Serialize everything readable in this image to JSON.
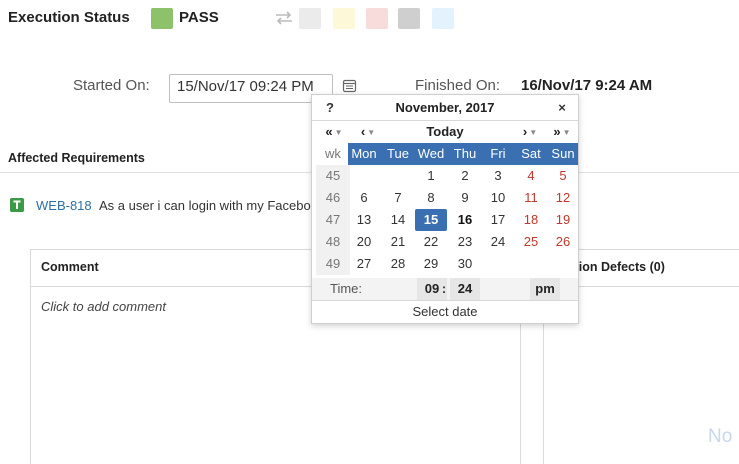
{
  "execution": {
    "label": "Execution Status",
    "status": "PASS",
    "status_color": "#8dc26a",
    "alt_status_colors": [
      "#ebebeb",
      "#fdf9d8",
      "#f7dcdc",
      "#cfcfcf",
      "#e3f2fc"
    ]
  },
  "dates": {
    "started_label": "Started On:",
    "started_value": "15/Nov/17 09:24 PM",
    "finished_label": "Finished On:",
    "finished_value": "16/Nov/17 9:24 AM"
  },
  "requirements": {
    "title": "Affected Requirements",
    "item": {
      "id": "WEB-818",
      "text": "As a user i can login with my Facebo"
    }
  },
  "comment": {
    "title": "Comment",
    "placeholder": "Click to add comment"
  },
  "defects": {
    "title": "cution Defects (0)",
    "empty": "No"
  },
  "calendar": {
    "help": "?",
    "month": "November, 2017",
    "close": "×",
    "nav": {
      "prev_year": "«",
      "prev_month": "‹",
      "today": "Today",
      "next_month": "›",
      "next_year": "»"
    },
    "headers": [
      "wk",
      "Mon",
      "Tue",
      "Wed",
      "Thu",
      "Fri",
      "Sat",
      "Sun"
    ],
    "weeks": [
      {
        "wk": "45",
        "days": [
          "",
          "",
          "1",
          "2",
          "3",
          "4",
          "5"
        ]
      },
      {
        "wk": "46",
        "days": [
          "6",
          "7",
          "8",
          "9",
          "10",
          "11",
          "12"
        ]
      },
      {
        "wk": "47",
        "days": [
          "13",
          "14",
          "15",
          "16",
          "17",
          "18",
          "19"
        ]
      },
      {
        "wk": "48",
        "days": [
          "20",
          "21",
          "22",
          "23",
          "24",
          "25",
          "26"
        ]
      },
      {
        "wk": "49",
        "days": [
          "27",
          "28",
          "29",
          "30",
          "",
          "",
          ""
        ]
      }
    ],
    "selected_day": "15",
    "today_day": "16",
    "time_label": "Time:",
    "hour": "09",
    "colon": ":",
    "minute": "24",
    "ampm": "pm",
    "select_label": "Select date",
    "header_color": "#3a6fb2"
  }
}
